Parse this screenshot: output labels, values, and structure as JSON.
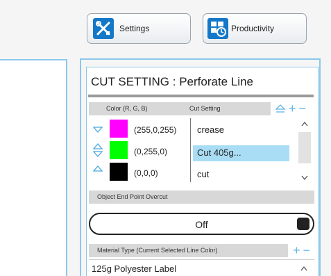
{
  "toolbar": {
    "settings_label": "Settings",
    "productivity_label": "Productivity"
  },
  "cut_setting": {
    "title": "CUT SETTING : Perforate Line",
    "color_header": "Color (R, G, B)",
    "cut_header": "Cut Setting",
    "rows": [
      {
        "swatch": "#ff00ff",
        "rgb": "(255,0,255)",
        "cut": "crease",
        "indicator": "down"
      },
      {
        "swatch": "#00ff00",
        "rgb": "(0,255,0)",
        "cut": "Cut 405g...",
        "indicator": "updown",
        "selected": true
      },
      {
        "swatch": "#000000",
        "rgb": "(0,0,0)",
        "cut": "cut",
        "indicator": "up"
      }
    ]
  },
  "overcut": {
    "header": "Object End Point Overcut",
    "value": "Off"
  },
  "material": {
    "header": "Material Type (Current Selected Line Color)",
    "value": "125g Polyester Label"
  },
  "colors": {
    "accent": "#1478c8",
    "frame": "#8ac8ea",
    "selection": "#a9ddf5"
  }
}
